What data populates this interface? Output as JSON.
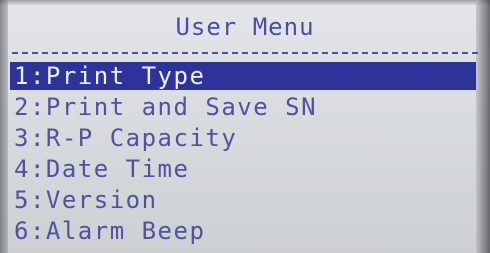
{
  "menu": {
    "title": "User Menu",
    "items": [
      {
        "label": "1:Print Type",
        "selected": true
      },
      {
        "label": "2:Print and Save SN",
        "selected": false
      },
      {
        "label": "3:R-P Capacity",
        "selected": false
      },
      {
        "label": "4:Date Time",
        "selected": false
      },
      {
        "label": "5:Version",
        "selected": false
      },
      {
        "label": "6:Alarm Beep",
        "selected": false
      }
    ]
  },
  "colors": {
    "text": "#4f539f",
    "highlight_bg": "#2e3399",
    "highlight_text": "#eef0ff",
    "screen_bg": "#dcdfe2"
  }
}
